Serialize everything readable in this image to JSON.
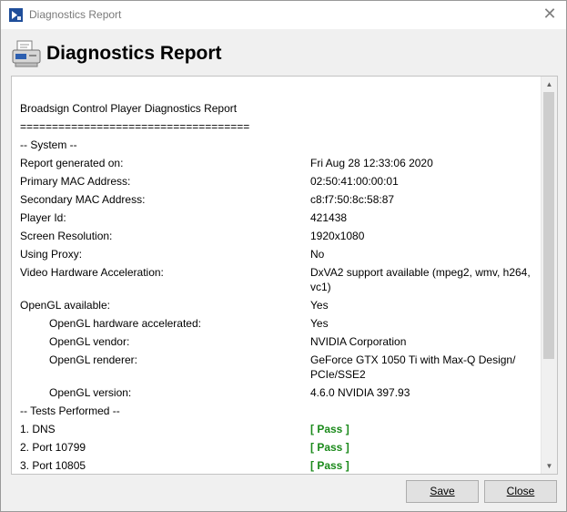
{
  "window": {
    "title": "Diagnostics Report"
  },
  "header": {
    "title": "Diagnostics Report"
  },
  "report": {
    "heading": "Broadsign Control Player Diagnostics Report",
    "separator": "====================================",
    "system_heading": "-- System --",
    "rows": [
      {
        "label": "Report generated on:",
        "value": "Fri Aug 28 12:33:06 2020",
        "indent": false
      },
      {
        "label": "Primary MAC Address:",
        "value": "02:50:41:00:00:01",
        "indent": false
      },
      {
        "label": "Secondary MAC Address:",
        "value": "c8:f7:50:8c:58:87",
        "indent": false
      },
      {
        "label": "Player Id:",
        "value": "421438",
        "indent": false
      },
      {
        "label": "Screen Resolution:",
        "value": "1920x1080",
        "indent": false
      },
      {
        "label": "Using Proxy:",
        "value": "No",
        "indent": false
      },
      {
        "label": "Video Hardware Acceleration:",
        "value": "DxVA2 support available (mpeg2, wmv, h264, vc1)",
        "indent": false
      },
      {
        "label": "OpenGL available:",
        "value": "Yes",
        "indent": false
      },
      {
        "label": "OpenGL hardware accelerated:",
        "value": "Yes",
        "indent": true
      },
      {
        "label": "OpenGL vendor:",
        "value": "NVIDIA Corporation",
        "indent": true
      },
      {
        "label": "OpenGL renderer:",
        "value": "GeForce GTX 1050 Ti with Max-Q Design/ PCIe/SSE2",
        "indent": true
      },
      {
        "label": "OpenGL version:",
        "value": "4.6.0 NVIDIA 397.93",
        "indent": true
      }
    ],
    "tests_heading": "-- Tests Performed --",
    "tests": [
      {
        "label": "1. DNS",
        "result": "[ Pass ]"
      },
      {
        "label": "2. Port 10799",
        "result": "[ Pass ]"
      },
      {
        "label": "3. Port 10805",
        "result": "[ Pass ]"
      }
    ]
  },
  "buttons": {
    "save": "Save",
    "close": "Close"
  },
  "colors": {
    "pass": "#1b8a1b"
  },
  "icons": {
    "title": "app-logo-icon",
    "header": "diagnostics-printer-icon",
    "close": "close-icon"
  }
}
